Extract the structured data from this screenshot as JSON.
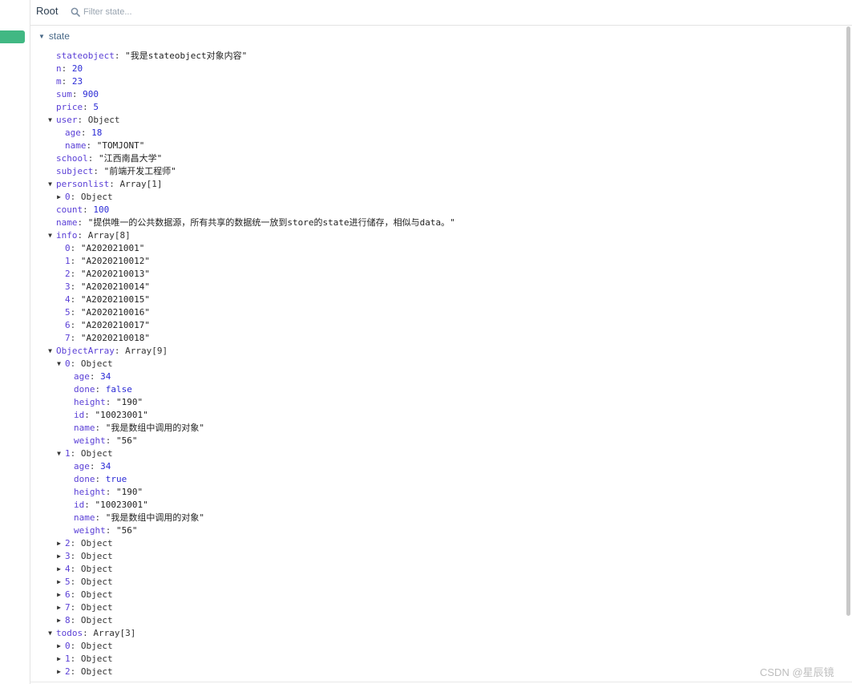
{
  "header": {
    "title": "Root",
    "search_placeholder": "Filter state..."
  },
  "section": {
    "label": "state"
  },
  "tree": [
    {
      "indent": 0,
      "arrow": "",
      "key": "stateobject",
      "value": "\"我是stateobject对象内容\"",
      "kind": "str"
    },
    {
      "indent": 0,
      "arrow": "",
      "key": "n",
      "value": "20",
      "kind": "num"
    },
    {
      "indent": 0,
      "arrow": "",
      "key": "m",
      "value": "23",
      "kind": "num"
    },
    {
      "indent": 0,
      "arrow": "",
      "key": "sum",
      "value": "900",
      "kind": "num"
    },
    {
      "indent": 0,
      "arrow": "",
      "key": "price",
      "value": "5",
      "kind": "num"
    },
    {
      "indent": 0,
      "arrow": "down",
      "key": "user",
      "value": "Object",
      "kind": "type"
    },
    {
      "indent": 1,
      "arrow": "",
      "key": "age",
      "value": "18",
      "kind": "num"
    },
    {
      "indent": 1,
      "arrow": "",
      "key": "name",
      "value": "\"TOMJONT\"",
      "kind": "str"
    },
    {
      "indent": 0,
      "arrow": "",
      "key": "school",
      "value": "\"江西南昌大学\"",
      "kind": "str"
    },
    {
      "indent": 0,
      "arrow": "",
      "key": "subject",
      "value": "\"前端开发工程师\"",
      "kind": "str"
    },
    {
      "indent": 0,
      "arrow": "down",
      "key": "personlist",
      "value": "Array[1]",
      "kind": "type"
    },
    {
      "indent": 1,
      "arrow": "right",
      "key": "0",
      "value": "Object",
      "kind": "type"
    },
    {
      "indent": 0,
      "arrow": "",
      "key": "count",
      "value": "100",
      "kind": "num"
    },
    {
      "indent": 0,
      "arrow": "",
      "key": "name",
      "value": "\"提供唯一的公共数据源，所有共享的数据统一放到store的state进行储存，相似与data。\"",
      "kind": "str"
    },
    {
      "indent": 0,
      "arrow": "down",
      "key": "info",
      "value": "Array[8]",
      "kind": "type"
    },
    {
      "indent": 1,
      "arrow": "",
      "key": "0",
      "value": "\"A202021001\"",
      "kind": "str"
    },
    {
      "indent": 1,
      "arrow": "",
      "key": "1",
      "value": "\"A2020210012\"",
      "kind": "str"
    },
    {
      "indent": 1,
      "arrow": "",
      "key": "2",
      "value": "\"A2020210013\"",
      "kind": "str"
    },
    {
      "indent": 1,
      "arrow": "",
      "key": "3",
      "value": "\"A2020210014\"",
      "kind": "str"
    },
    {
      "indent": 1,
      "arrow": "",
      "key": "4",
      "value": "\"A2020210015\"",
      "kind": "str"
    },
    {
      "indent": 1,
      "arrow": "",
      "key": "5",
      "value": "\"A2020210016\"",
      "kind": "str"
    },
    {
      "indent": 1,
      "arrow": "",
      "key": "6",
      "value": "\"A2020210017\"",
      "kind": "str"
    },
    {
      "indent": 1,
      "arrow": "",
      "key": "7",
      "value": "\"A2020210018\"",
      "kind": "str"
    },
    {
      "indent": 0,
      "arrow": "down",
      "key": "ObjectArray",
      "value": "Array[9]",
      "kind": "type"
    },
    {
      "indent": 1,
      "arrow": "down",
      "key": "0",
      "value": "Object",
      "kind": "type"
    },
    {
      "indent": 2,
      "arrow": "",
      "key": "age",
      "value": "34",
      "kind": "num"
    },
    {
      "indent": 2,
      "arrow": "",
      "key": "done",
      "value": "false",
      "kind": "bool"
    },
    {
      "indent": 2,
      "arrow": "",
      "key": "height",
      "value": "\"190\"",
      "kind": "str"
    },
    {
      "indent": 2,
      "arrow": "",
      "key": "id",
      "value": "\"10023001\"",
      "kind": "str"
    },
    {
      "indent": 2,
      "arrow": "",
      "key": "name",
      "value": "\"我是数组中调用的对象\"",
      "kind": "str"
    },
    {
      "indent": 2,
      "arrow": "",
      "key": "weight",
      "value": "\"56\"",
      "kind": "str"
    },
    {
      "indent": 1,
      "arrow": "down",
      "key": "1",
      "value": "Object",
      "kind": "type"
    },
    {
      "indent": 2,
      "arrow": "",
      "key": "age",
      "value": "34",
      "kind": "num"
    },
    {
      "indent": 2,
      "arrow": "",
      "key": "done",
      "value": "true",
      "kind": "bool"
    },
    {
      "indent": 2,
      "arrow": "",
      "key": "height",
      "value": "\"190\"",
      "kind": "str"
    },
    {
      "indent": 2,
      "arrow": "",
      "key": "id",
      "value": "\"10023001\"",
      "kind": "str"
    },
    {
      "indent": 2,
      "arrow": "",
      "key": "name",
      "value": "\"我是数组中调用的对象\"",
      "kind": "str"
    },
    {
      "indent": 2,
      "arrow": "",
      "key": "weight",
      "value": "\"56\"",
      "kind": "str"
    },
    {
      "indent": 1,
      "arrow": "right",
      "key": "2",
      "value": "Object",
      "kind": "type"
    },
    {
      "indent": 1,
      "arrow": "right",
      "key": "3",
      "value": "Object",
      "kind": "type"
    },
    {
      "indent": 1,
      "arrow": "right",
      "key": "4",
      "value": "Object",
      "kind": "type"
    },
    {
      "indent": 1,
      "arrow": "right",
      "key": "5",
      "value": "Object",
      "kind": "type"
    },
    {
      "indent": 1,
      "arrow": "right",
      "key": "6",
      "value": "Object",
      "kind": "type"
    },
    {
      "indent": 1,
      "arrow": "right",
      "key": "7",
      "value": "Object",
      "kind": "type"
    },
    {
      "indent": 1,
      "arrow": "right",
      "key": "8",
      "value": "Object",
      "kind": "type"
    },
    {
      "indent": 0,
      "arrow": "down",
      "key": "todos",
      "value": "Array[3]",
      "kind": "type"
    },
    {
      "indent": 1,
      "arrow": "right",
      "key": "0",
      "value": "Object",
      "kind": "type"
    },
    {
      "indent": 1,
      "arrow": "right",
      "key": "1",
      "value": "Object",
      "kind": "type"
    },
    {
      "indent": 1,
      "arrow": "right",
      "key": "2",
      "value": "Object",
      "kind": "type"
    }
  ],
  "watermark": "CSDN @星辰镜",
  "colors": {
    "accent": "#41b883",
    "key": "#5a3fd6",
    "number": "#2b2bd6"
  }
}
